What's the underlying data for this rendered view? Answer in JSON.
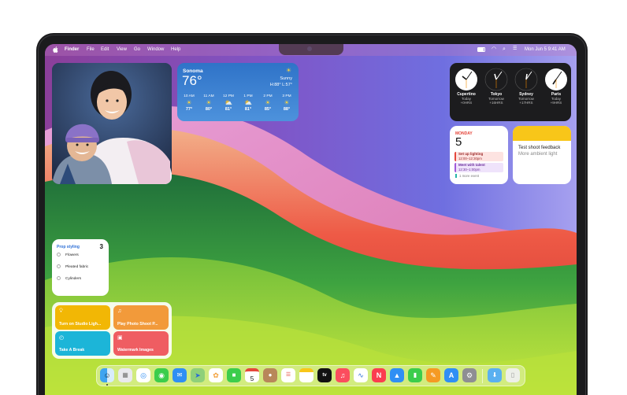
{
  "menubar": {
    "app_name": "Finder",
    "menus": [
      "File",
      "Edit",
      "View",
      "Go",
      "Window",
      "Help"
    ],
    "clock": "Mon Jun 5  9:41 AM"
  },
  "weather": {
    "city": "Sonoma",
    "temp": "76°",
    "condition": "Sunny",
    "high_low": "H:88° L:57°",
    "hours": [
      {
        "time": "10 AM",
        "icon": "sun-icon",
        "temp": "77°"
      },
      {
        "time": "11 AM",
        "icon": "sun-icon",
        "temp": "80°"
      },
      {
        "time": "12 PM",
        "icon": "partly-cloudy-icon",
        "temp": "81°"
      },
      {
        "time": "1 PM",
        "icon": "partly-cloudy-icon",
        "temp": "81°"
      },
      {
        "time": "2 PM",
        "icon": "sun-icon",
        "temp": "85°"
      },
      {
        "time": "3 PM",
        "icon": "sun-icon",
        "temp": "88°"
      }
    ]
  },
  "clocks": [
    {
      "city": "Cupertino",
      "day": "Today",
      "offset": "+0HRS"
    },
    {
      "city": "Tokyo",
      "day": "Tomorrow",
      "offset": "+16HRS"
    },
    {
      "city": "Sydney",
      "day": "Tomorrow",
      "offset": "+17HRS"
    },
    {
      "city": "Paris",
      "day": "Today",
      "offset": "+9HRS"
    }
  ],
  "calendar": {
    "weekday": "MONDAY",
    "day": "5",
    "events": [
      {
        "title": "Set up lighting",
        "time": "12:00–12:30pm"
      },
      {
        "title": "Meet with talent",
        "time": "12:30–1:00pm"
      }
    ],
    "more": "1 more event"
  },
  "notes": {
    "title": "Test shoot feedback",
    "subtitle": "More ambient light"
  },
  "reminders": {
    "list_name": "Prop styling",
    "count": "3",
    "items": [
      "Flowers",
      "Pleated fabric",
      "Cylinders"
    ]
  },
  "shortcuts": [
    {
      "label": "Turn on Studio Ligh...",
      "icon": "lightbulb-icon",
      "color": "#f2b705"
    },
    {
      "label": "Play Photo Shoot P...",
      "icon": "music-note-icon",
      "color": "#f29a3a"
    },
    {
      "label": "Take A Break",
      "icon": "timer-icon",
      "color": "#1cb5d8"
    },
    {
      "label": "Watermark Images",
      "icon": "photo-icon",
      "color": "#ef5d62"
    }
  ],
  "dock": {
    "calendar_day": "5",
    "apps": [
      "Finder",
      "Launchpad",
      "Safari",
      "Messages",
      "Mail",
      "Maps",
      "Photos",
      "FaceTime",
      "Calendar",
      "Contacts",
      "Reminders",
      "Notes",
      "TV",
      "Music",
      "Freeform",
      "News",
      "Keynote",
      "Numbers",
      "Pages",
      "App Store",
      "System Settings",
      "Downloads",
      "Trash"
    ]
  },
  "colors": {
    "accent_red": "#e5463b",
    "reminder_blue": "#2d6fd6",
    "notes_yellow": "#f8c619"
  }
}
